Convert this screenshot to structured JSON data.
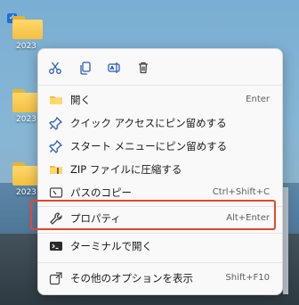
{
  "desktop": {
    "icons": [
      {
        "label": "2023"
      },
      {
        "label": "2023"
      },
      {
        "label": "2023"
      }
    ]
  },
  "toolbar": [
    {
      "name": "cut-icon"
    },
    {
      "name": "copy-icon"
    },
    {
      "name": "rename-icon"
    },
    {
      "name": "delete-icon"
    }
  ],
  "menu": {
    "items": [
      {
        "label": "開く",
        "shortcut": "Enter",
        "icon": "folder-icon"
      },
      {
        "label": "クイック アクセスにピン留めする",
        "shortcut": "",
        "icon": "pin-icon"
      },
      {
        "label": "スタート メニューにピン留めする",
        "shortcut": "",
        "icon": "pin-icon"
      },
      {
        "label": "ZIP ファイルに圧縮する",
        "shortcut": "",
        "icon": "zip-folder-icon"
      },
      {
        "label": "パスのコピー",
        "shortcut": "Ctrl+Shift+C",
        "icon": "copy-path-icon"
      },
      {
        "label": "プロパティ",
        "shortcut": "Alt+Enter",
        "icon": "wrench-icon"
      },
      {
        "label": "ターミナルで開く",
        "shortcut": "",
        "icon": "terminal-icon"
      },
      {
        "label": "その他のオプションを表示",
        "shortcut": "Shift+F10",
        "icon": "more-options-icon"
      }
    ]
  },
  "colors": {
    "highlight": "#e8452a",
    "accent": "#1b6fd6"
  }
}
